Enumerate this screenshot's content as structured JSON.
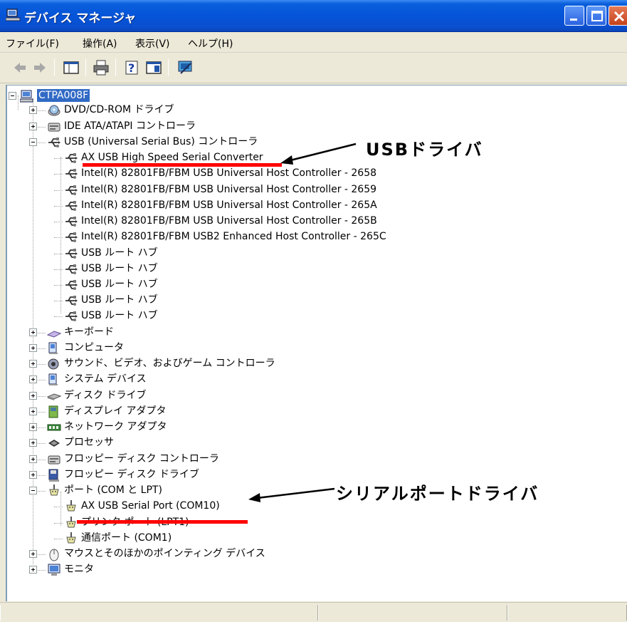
{
  "window": {
    "title": "デバイス マネージャ"
  },
  "menu": [
    {
      "label": "ファイル(F)"
    },
    {
      "label": "操作(A)"
    },
    {
      "label": "表示(V)"
    },
    {
      "label": "ヘルプ(H)"
    }
  ],
  "toolbar": {
    "icons": [
      "back-icon",
      "forward-icon",
      "console-tree-icon",
      "print-icon",
      "help-icon",
      "properties-icon",
      "scan-hardware-icon"
    ]
  },
  "tree": {
    "root": "CTPA008F",
    "nodes": [
      {
        "label": "DVD/CD-ROM ドライブ",
        "icon": "cd-drive-icon"
      },
      {
        "label": "IDE ATA/ATAPI コントローラ",
        "icon": "ide-controller-icon"
      },
      {
        "label": "USB (Universal Serial Bus) コントローラ",
        "icon": "usb-icon"
      },
      {
        "label": "AX USB High Speed Serial Converter",
        "icon": "usb-icon"
      },
      {
        "label": "Intel(R) 82801FB/FBM USB Universal Host Controller - 2658",
        "icon": "usb-icon"
      },
      {
        "label": "Intel(R) 82801FB/FBM USB Universal Host Controller - 2659",
        "icon": "usb-icon"
      },
      {
        "label": "Intel(R) 82801FB/FBM USB Universal Host Controller - 265A",
        "icon": "usb-icon"
      },
      {
        "label": "Intel(R) 82801FB/FBM USB Universal Host Controller - 265B",
        "icon": "usb-icon"
      },
      {
        "label": "Intel(R) 82801FB/FBM USB2 Enhanced Host Controller - 265C",
        "icon": "usb-icon"
      },
      {
        "label": "USB ルート ハブ",
        "icon": "usb-icon"
      },
      {
        "label": "USB ルート ハブ",
        "icon": "usb-icon"
      },
      {
        "label": "USB ルート ハブ",
        "icon": "usb-icon"
      },
      {
        "label": "USB ルート ハブ",
        "icon": "usb-icon"
      },
      {
        "label": "USB ルート ハブ",
        "icon": "usb-icon"
      },
      {
        "label": "キーボード",
        "icon": "keyboard-icon"
      },
      {
        "label": "コンピュータ",
        "icon": "computer-icon"
      },
      {
        "label": "サウンド、ビデオ、およびゲーム コントローラ",
        "icon": "sound-icon"
      },
      {
        "label": "システム デバイス",
        "icon": "system-device-icon"
      },
      {
        "label": "ディスク ドライブ",
        "icon": "disk-drive-icon"
      },
      {
        "label": "ディスプレイ アダプタ",
        "icon": "display-adapter-icon"
      },
      {
        "label": "ネットワーク アダプタ",
        "icon": "network-adapter-icon"
      },
      {
        "label": "プロセッサ",
        "icon": "processor-icon"
      },
      {
        "label": "フロッピー ディスク コントローラ",
        "icon": "floppy-controller-icon"
      },
      {
        "label": "フロッピー ディスク ドライブ",
        "icon": "floppy-drive-icon"
      },
      {
        "label": "ポート (COM と LPT)",
        "icon": "port-icon"
      },
      {
        "label": "AX USB Serial Port (COM10)",
        "icon": "port-icon"
      },
      {
        "label": "プリンタ ポート (LPT1)",
        "icon": "port-icon"
      },
      {
        "label": "通信ポート (COM1)",
        "icon": "port-icon"
      },
      {
        "label": "マウスとそのほかのポインティング デバイス",
        "icon": "mouse-icon"
      },
      {
        "label": "モニタ",
        "icon": "monitor-icon"
      }
    ]
  },
  "annotations": {
    "usb_driver": "USBドライバ",
    "serial_port_driver": "シリアルポートドライバ",
    "highlight_color": "#ff0000"
  },
  "colors": {
    "title_bar": "#0554d8",
    "selection": "#316ac5"
  }
}
